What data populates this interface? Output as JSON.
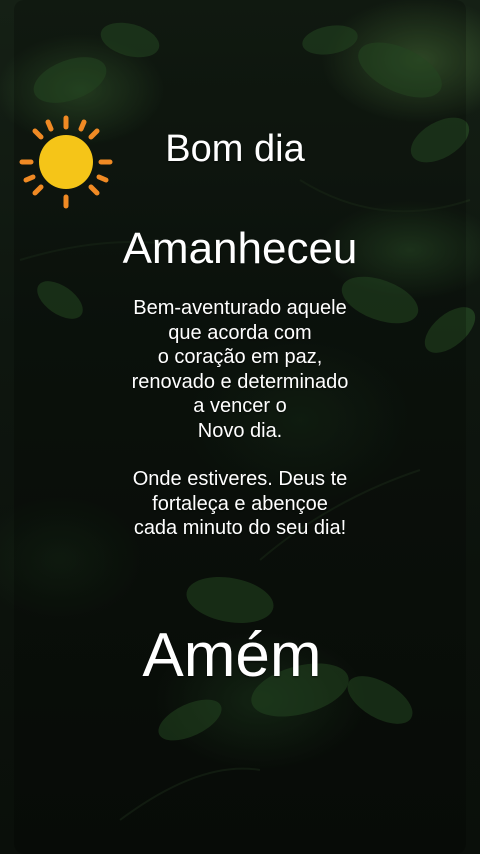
{
  "greeting": "Bom dia",
  "title": "Amanheceu",
  "message_lines": [
    "Bem-aventurado aquele",
    "que acorda com",
    "o coração em paz,",
    "renovado e determinado",
    "a vencer o",
    "Novo dia."
  ],
  "blessing_lines": [
    "Onde estiveres. Deus te",
    "fortaleça e abençoe",
    "cada minuto do seu dia!"
  ],
  "closing": "Amém",
  "colors": {
    "sun_fill": "#f5c518",
    "sun_rays": "#f08a24",
    "text": "#ffffff",
    "foliage": "#2f5a2a"
  },
  "icons": [
    "sun-icon"
  ]
}
